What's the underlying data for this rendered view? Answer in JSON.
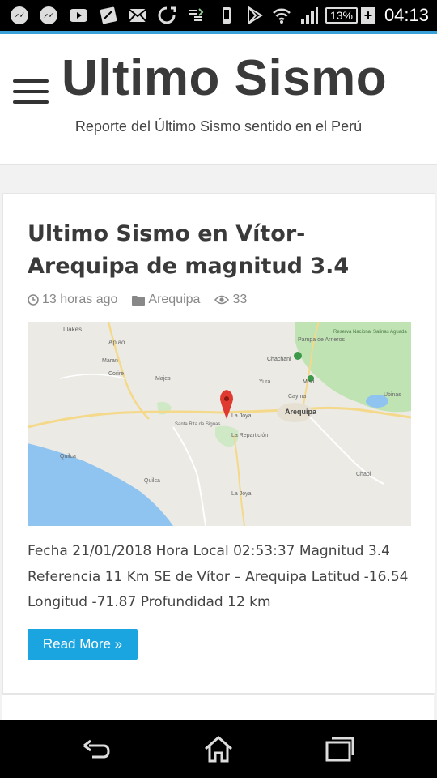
{
  "status_bar": {
    "battery": "13%",
    "time": "04:13",
    "icons": [
      "messenger-icon",
      "messenger-icon",
      "youtube-icon",
      "sketch-app-icon",
      "mail-icon",
      "sync-icon",
      "data-transfer-icon",
      "phone-icon",
      "play-store-icon",
      "wifi-icon",
      "signal-icon",
      "battery-icon"
    ]
  },
  "header": {
    "title": "Ultimo Sismo",
    "tagline": "Reporte del Último Sismo sentido en el Perú"
  },
  "article": {
    "title": "Ultimo Sismo en Vítor-Arequipa de magnitud 3.4",
    "meta": {
      "time_ago": "13 horas ago",
      "category": "Arequipa",
      "views": "33"
    },
    "map_labels": {
      "llakes": "Llakes",
      "aplao": "Aplao",
      "maran": "Maran",
      "corire": "Corire",
      "majes": "Majes",
      "pampa": "Pampa de Arrieros",
      "chachani": "Chachani",
      "reserva": "Reserva Nacional Salinas Aguada",
      "misti": "Misti",
      "yura": "Yura",
      "cayma": "Cayma",
      "la_joya": "La Joya",
      "arequipa": "Arequipa",
      "santa_rita": "Santa Rita de Siguas",
      "la_reparticion": "La Repartición",
      "la_joya2": "La Joya",
      "quilca": "Quilca",
      "chapi": "Chapi",
      "ubinas": "Ubinas"
    },
    "excerpt": "Fecha 21/01/2018 Hora Local 02:53:37 Magnitud 3.4 Referencia 11 Km SE de Vítor – Arequipa Latitud -16.54 Longitud -71.87 Profundidad 12 km",
    "read_more": "Read More »"
  },
  "colors": {
    "accent": "#3aa0d8",
    "button": "#1aa4e0",
    "pin": "#e03a30",
    "water": "#8fc4f0",
    "park": "#bfe3b3"
  }
}
